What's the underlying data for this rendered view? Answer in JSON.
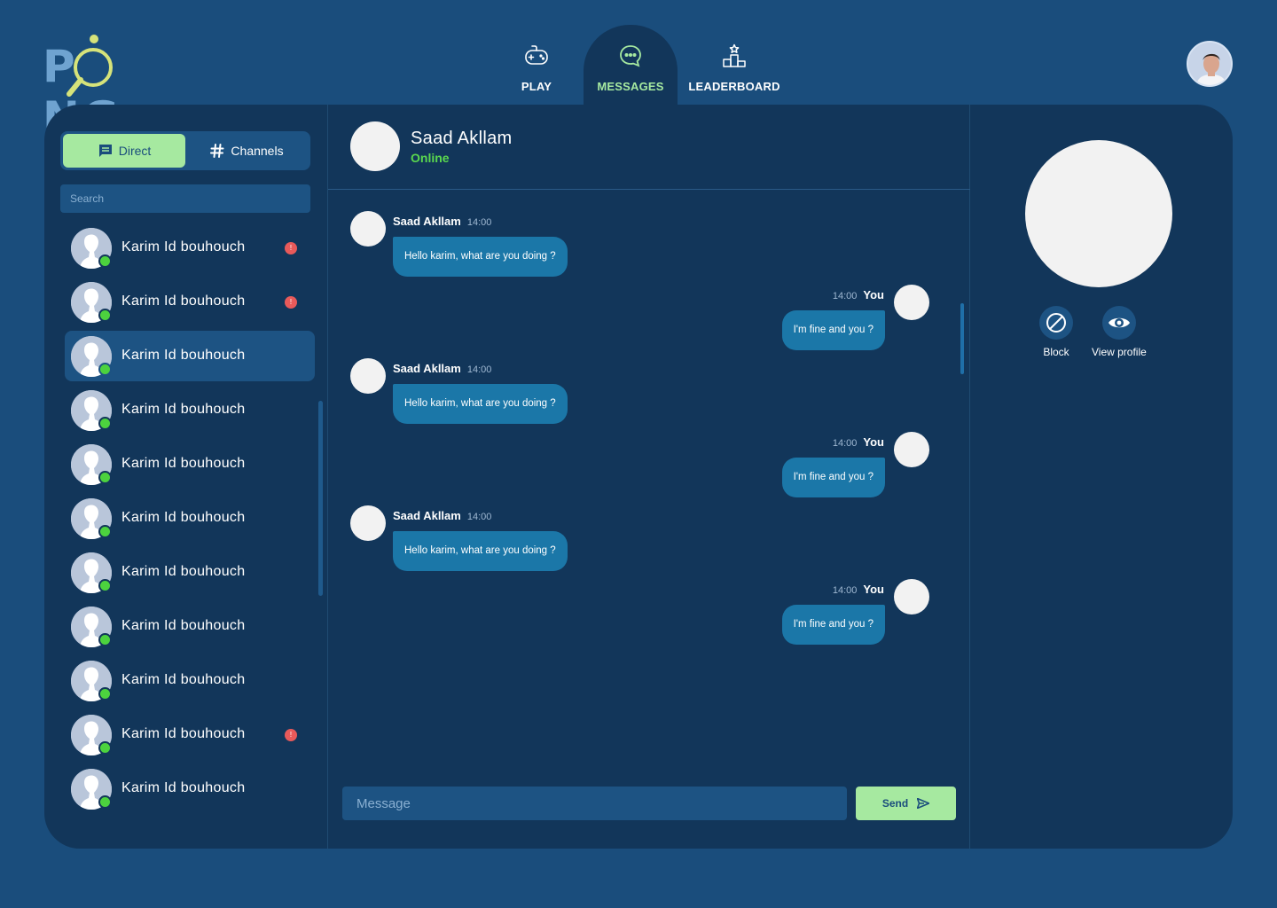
{
  "app": {
    "logo": "PONG"
  },
  "nav": {
    "tabs": [
      {
        "label": "PLAY",
        "icon": "gamepad-icon"
      },
      {
        "label": "MESSAGES",
        "icon": "chat-bubble-icon"
      },
      {
        "label": "LEADERBOARD",
        "icon": "podium-icon"
      }
    ],
    "active": "MESSAGES"
  },
  "sidebar": {
    "toggle": {
      "direct": "Direct",
      "channels": "Channels",
      "active": "Direct"
    },
    "search_placeholder": "Search",
    "contacts": [
      {
        "name": "Karim Id bouhouch",
        "online": true,
        "badge": "!"
      },
      {
        "name": "Karim Id bouhouch",
        "online": true,
        "badge": "!"
      },
      {
        "name": "Karim Id bouhouch",
        "online": true,
        "selected": true
      },
      {
        "name": "Karim Id bouhouch",
        "online": true
      },
      {
        "name": "Karim Id bouhouch",
        "online": true
      },
      {
        "name": "Karim Id bouhouch",
        "online": true
      },
      {
        "name": "Karim Id bouhouch",
        "online": true
      },
      {
        "name": "Karim Id bouhouch",
        "online": true
      },
      {
        "name": "Karim Id bouhouch",
        "online": true
      },
      {
        "name": "Karim Id bouhouch",
        "online": true,
        "badge": "!"
      },
      {
        "name": "Karim Id bouhouch",
        "online": true
      }
    ]
  },
  "chat": {
    "contact_name": "Saad Akllam",
    "contact_status": "Online",
    "messages": [
      {
        "sender": "Saad Akllam",
        "time": "14:00",
        "text": "Hello karim, what are you doing ?"
      },
      {
        "sender": "You",
        "time": "14:00",
        "text": "I'm fine and you ?"
      },
      {
        "sender": "Saad Akllam",
        "time": "14:00",
        "text": "Hello karim, what are you doing ?"
      },
      {
        "sender": "You",
        "time": "14:00",
        "text": "I'm fine and you ?"
      },
      {
        "sender": "Saad Akllam",
        "time": "14:00",
        "text": "Hello karim, what are you doing ?"
      },
      {
        "sender": "You",
        "time": "14:00",
        "text": "I'm fine and you ?"
      }
    ],
    "input_placeholder": "Message",
    "send_label": "Send"
  },
  "profile": {
    "actions": [
      {
        "label": "Block",
        "icon": "block-icon"
      },
      {
        "label": "View profile",
        "icon": "eye-icon"
      }
    ]
  },
  "colors": {
    "background": "#1a4d7c",
    "panel": "#12365a",
    "accent_green": "#a6e9a0",
    "online_green": "#4cd23e",
    "bubble": "#1b77a8",
    "badge_red": "#e85a5a"
  }
}
